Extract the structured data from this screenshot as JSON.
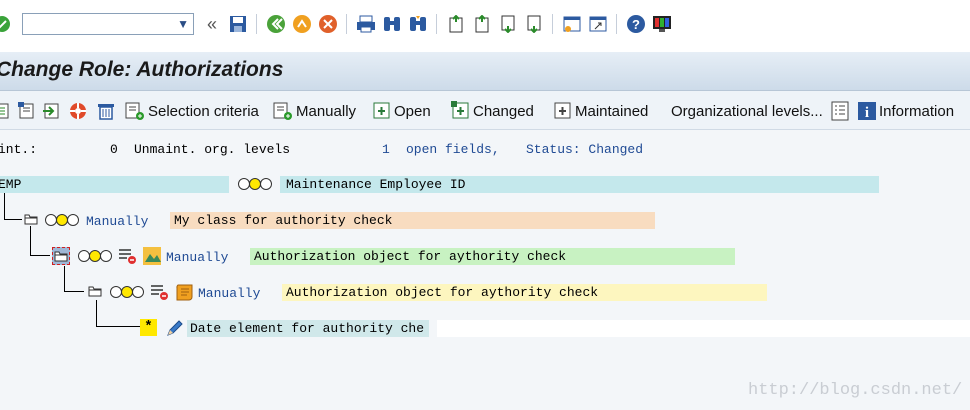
{
  "system_toolbar": {
    "command_field_value": "",
    "icons": [
      "check-icon",
      "back-icon",
      "save-icon",
      "back-green-icon",
      "exit-icon",
      "cancel-icon",
      "print-icon",
      "find-icon",
      "find-next-icon",
      "first-page-icon",
      "prev-page-icon",
      "next-page-icon",
      "last-page-icon",
      "new-session-icon",
      "shortcut-icon",
      "help-icon",
      "customize-layout-icon"
    ]
  },
  "title": "Change Role: Authorizations",
  "app_toolbar": {
    "selection_criteria": "Selection criteria",
    "manually": "Manually",
    "open": "Open",
    "changed": "Changed",
    "maintained": "Maintained",
    "org_levels": "Organizational levels...",
    "information": "Information"
  },
  "status_line": {
    "maint_label": "int.:",
    "maint_value": "0",
    "unmaint_label": "Unmaint. org. levels",
    "open_count": "1",
    "open_label": "open fields,",
    "status_label": "Status: Changed"
  },
  "tree": {
    "root": {
      "id": "EMP",
      "description": "Maintenance Employee ID"
    },
    "class_node": {
      "source": "Manually",
      "description": "My class for authority check"
    },
    "object_node": {
      "source": "Manually",
      "description": "Authorization object for aythority check"
    },
    "auth_node": {
      "source": "Manually",
      "description": "Authorization object for aythority check"
    },
    "field_node": {
      "marker": "*",
      "description": "Date element for authority che",
      "value": ""
    }
  },
  "watermark": "http://blog.csdn.net/",
  "colors": {
    "root_bar": "#c4e8ec",
    "class_bar": "#f8dcc0",
    "object_bar": "#c8f2c2",
    "auth_bar": "#fdf6bf",
    "field_bar": "#d0e8ea",
    "link_blue": "#1f4a94"
  }
}
